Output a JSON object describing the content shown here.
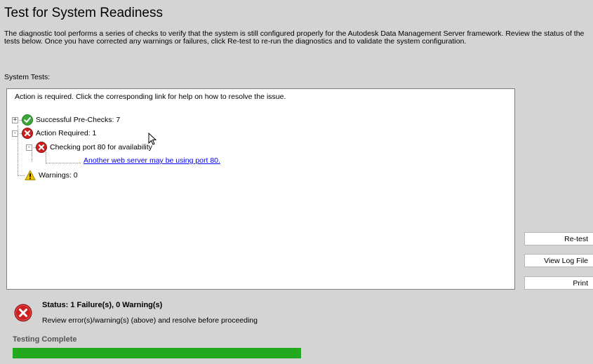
{
  "title": "Test for System Readiness",
  "description": "The diagnostic tool performs a series of checks to verify that the system is still configured properly for the Autodesk Data Management Server framework. Review the status of the tests below.  Once you have corrected any warnings or failures, click Re-test to re-run the diagnostics and to validate the system configuration.",
  "system_tests_label": "System Tests:",
  "tree": {
    "header": "Action is required. Click the corresponding link for help on how to resolve the issue.",
    "nodes": [
      {
        "label": "Successful Pre-Checks: 7",
        "icon": "check-icon",
        "expander": "+"
      },
      {
        "label": "Action Required: 1",
        "icon": "error-icon",
        "expander": "-"
      },
      {
        "label": "Checking port 80 for availability",
        "icon": "error-icon",
        "expander": "-"
      },
      {
        "label": "Another web server may be using port 80.",
        "icon": "link"
      },
      {
        "label": "Warnings: 0",
        "icon": "warning-icon"
      }
    ]
  },
  "buttons": {
    "retest": "Re-test",
    "view_log": "View Log File",
    "print": "Print"
  },
  "status": {
    "title": "Status: 1 Failure(s), 0 Warning(s)",
    "subtitle": "Review error(s)/warning(s) (above) and resolve before proceeding",
    "icon": "error-icon"
  },
  "progress": {
    "label": "Testing Complete",
    "fraction": 1.0,
    "color": "#22a91e"
  },
  "colors": {
    "background": "#d4d4d4",
    "error": "#cc2020",
    "success": "#3aa63a",
    "warning": "#f2c200",
    "link": "#0000ee"
  }
}
